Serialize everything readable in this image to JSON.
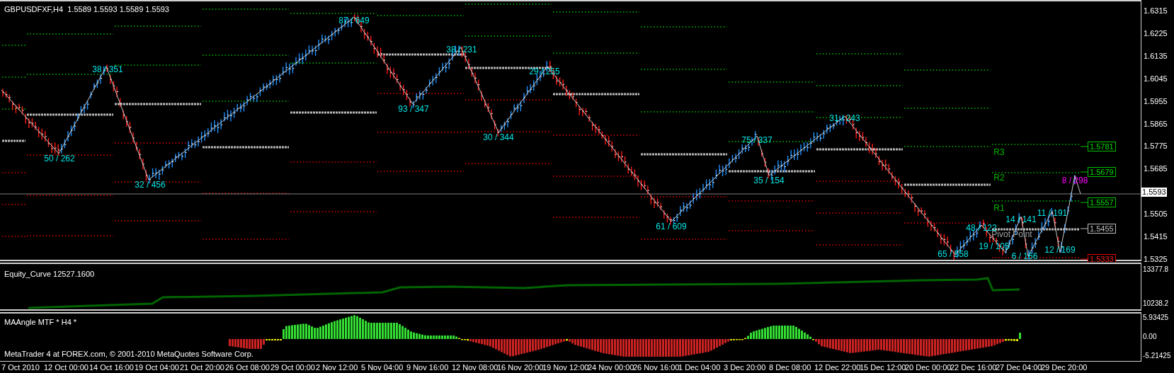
{
  "chart": {
    "header": "GBPUSDFXF,H4  1.5589 1.5593 1.5589 1.5593",
    "swing_labels": [
      {
        "text": "50 / 262",
        "kind": "swing"
      },
      {
        "text": "38 / 351",
        "kind": "swing"
      },
      {
        "text": "32 / 456",
        "kind": "swing"
      },
      {
        "text": "87 / 649",
        "kind": "swing"
      },
      {
        "text": "93 / 347",
        "kind": "swing"
      },
      {
        "text": "38 / 231",
        "kind": "swing"
      },
      {
        "text": "30 / 344",
        "kind": "swing"
      },
      {
        "text": "29 / 255",
        "kind": "swing"
      },
      {
        "text": "61 / 609",
        "kind": "swing"
      },
      {
        "text": "75 / 337",
        "kind": "swing"
      },
      {
        "text": "35 / 154",
        "kind": "swing"
      },
      {
        "text": "31 / 243",
        "kind": "swing"
      },
      {
        "text": "65 / 558",
        "kind": "swing"
      },
      {
        "text": "48 / 122",
        "kind": "swing"
      },
      {
        "text": "14 / 141",
        "kind": "swing"
      },
      {
        "text": "11 / 191",
        "kind": "swing"
      },
      {
        "text": "19 / 105",
        "kind": "swing"
      },
      {
        "text": "6 / 166",
        "kind": "swing"
      },
      {
        "text": "12 / 169",
        "kind": "swing"
      },
      {
        "text": "8 / 298",
        "kind": "current"
      }
    ],
    "level_labels": [
      {
        "text": "R3",
        "kind": "resistance"
      },
      {
        "text": "R2",
        "kind": "resistance"
      },
      {
        "text": "R1",
        "kind": "resistance"
      },
      {
        "text": "Pivot Point",
        "kind": "pivot"
      }
    ],
    "level_tags": [
      {
        "text": "1.5781",
        "kind": "resistance"
      },
      {
        "text": "1.5679",
        "kind": "resistance"
      },
      {
        "text": "1.5557",
        "kind": "resistance"
      },
      {
        "text": "1.5455",
        "kind": "pivot"
      },
      {
        "text": "1.5333",
        "kind": "support"
      }
    ],
    "price_axis": [
      "1.6315",
      "1.6225",
      "1.6135",
      "1.6045",
      "1.5955",
      "1.5865",
      "1.5775",
      "1.5685",
      "1.5505",
      "1.5415",
      "1.5325"
    ],
    "current_price": "1.5593"
  },
  "equity_panel": {
    "title": "Equity_Curve 12527.1600",
    "axis": [
      "13377.8",
      "10238.2"
    ]
  },
  "indicator_panel": {
    "title": "MAAngle MTF * H4 *",
    "copyright": "MetaTrader 4 at FOREX.com, © 2001-2010 MetaQuotes Software Corp.",
    "axis": [
      "5.93425",
      "0.00",
      "-5.21425"
    ]
  },
  "time_axis": [
    "7 Oct 2010",
    "12 Oct 00:00",
    "14 Oct 16:00",
    "19 Oct 04:00",
    "21 Oct 20:00",
    "26 Oct 08:00",
    "29 Oct 00:00",
    "2 Nov 12:00",
    "5 Nov 04:00",
    "9 Nov 16:00",
    "12 Nov 08:00",
    "16 Nov 20:00",
    "19 Nov 12:00",
    "24 Nov 00:00",
    "26 Nov 16:00",
    "1 Dec 04:00",
    "3 Dec 20:00",
    "8 Dec 08:00",
    "12 Dec 22:00",
    "15 Dec 12:00",
    "20 Dec 00:00",
    "22 Dec 16:00",
    "27 Dec 04:00",
    "29 Dec 20:00"
  ]
}
